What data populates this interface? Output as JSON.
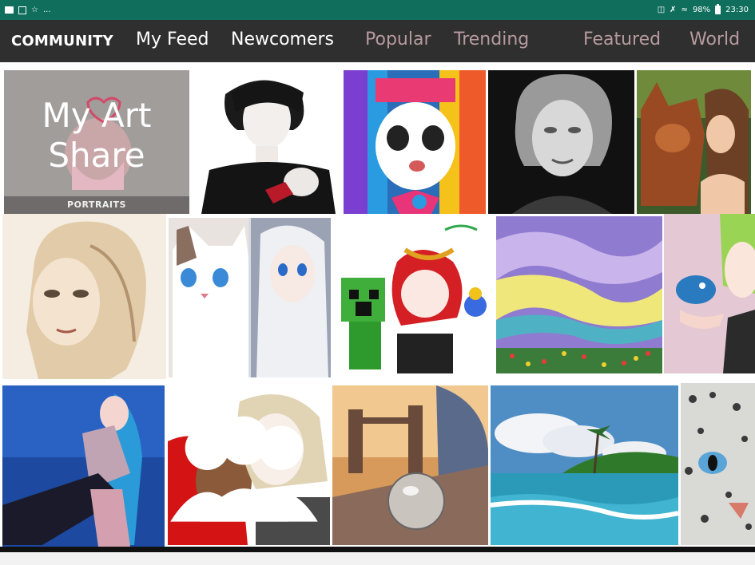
{
  "status_bar": {
    "left_icons": [
      "video-icon",
      "gallery-icon",
      "badge-icon",
      "more-dots-icon"
    ],
    "more": "...",
    "battery_percent": "98%",
    "time": "23:30",
    "right_icons": [
      "cast-icon",
      "mute-icon",
      "wifi-icon",
      "battery-icon"
    ]
  },
  "header": {
    "brand": "COMMUNITY",
    "tabs": [
      {
        "label": "My Feed",
        "state": "active"
      },
      {
        "label": "Newcomers",
        "state": "active"
      },
      {
        "label": "Popular",
        "state": "muted"
      },
      {
        "label": "Trending",
        "state": "muted"
      },
      {
        "label": "Featured",
        "state": "muted"
      },
      {
        "label": "World",
        "state": "muted"
      }
    ],
    "colors": {
      "bar": "#2f2f2f",
      "active": "#ffffff",
      "muted": "#b69a9f"
    }
  },
  "gallery": {
    "myart": {
      "title": "My Art Share",
      "category": "PORTRAITS"
    },
    "tiles": [
      {
        "icon": "artwork-dark-haired-man"
      },
      {
        "icon": "artwork-rainbow-hair-girl"
      },
      {
        "icon": "artwork-grayscale-portrait"
      },
      {
        "icon": "artwork-girl-with-wolf"
      },
      {
        "icon": "artwork-pencil-woman-portrait"
      },
      {
        "icon": "artwork-cat-and-white-hair-girl"
      },
      {
        "icon": "artwork-creeper-and-red-hair-chibi"
      },
      {
        "icon": "artwork-pastel-sky-painting"
      },
      {
        "icon": "artwork-green-hair-girl-with-bird"
      },
      {
        "icon": "artwork-blue-hair-singer"
      },
      {
        "icon": "artwork-anime-couple"
      },
      {
        "icon": "artwork-tower-bridge-glass-ball"
      },
      {
        "icon": "artwork-beach-palms"
      },
      {
        "icon": "artwork-snow-leopard"
      }
    ],
    "group_icon": "group-icon"
  }
}
